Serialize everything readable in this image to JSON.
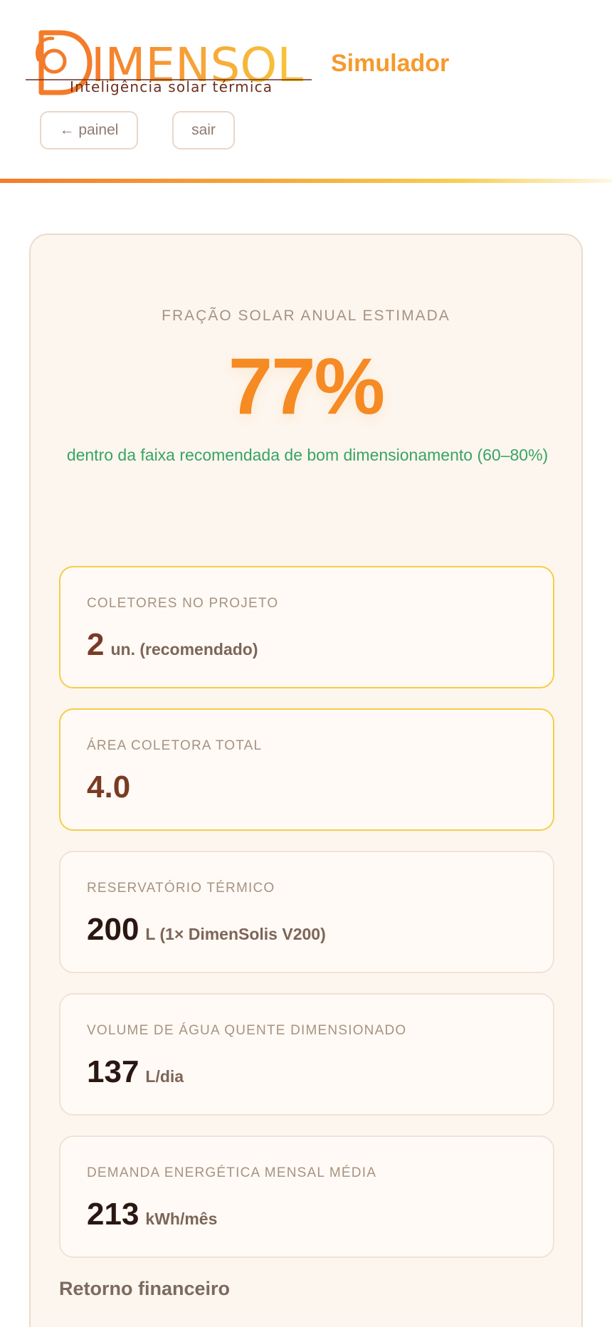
{
  "header": {
    "logo": {
      "wordmark": "DIMENSOL",
      "tagline": "Inteligência solar térmica",
      "colors": {
        "orange": "#f47b2a",
        "yellow": "#f7c93a",
        "brown": "#6b2f1f"
      }
    },
    "app_name": "Simulador",
    "buttons": {
      "painel": "← painel",
      "sair": "sair"
    },
    "accent_gradient": [
      "#f47b2a",
      "#f7cf55"
    ]
  },
  "result": {
    "kicker": "FRAÇÃO SOLAR ANUAL ESTIMADA",
    "solar_fraction": "77%",
    "status_text": "dentro da faixa recomendada de bom dimensionamento (60–80%)",
    "status_color": "#37a465"
  },
  "metrics": [
    {
      "label": "COLETORES NO PROJETO",
      "value": "2",
      "unit": "un. (recomendado)",
      "highlighted": true
    },
    {
      "label": "ÁREA COLETORA TOTAL",
      "value": "4.0",
      "unit": "",
      "highlighted": true
    },
    {
      "label": "RESERVATÓRIO TÉRMICO",
      "value": "200",
      "unit": "L (1× DimenSolis V200)",
      "highlighted": false
    },
    {
      "label": "VOLUME DE ÁGUA QUENTE DIMENSIONADO",
      "value": "137",
      "unit": "L/dia",
      "highlighted": false
    },
    {
      "label": "DEMANDA ENERGÉTICA MENSAL MÉDIA",
      "value": "213",
      "unit": "kWh/mês",
      "highlighted": false
    }
  ],
  "section": {
    "title": "Retorno financeiro"
  }
}
